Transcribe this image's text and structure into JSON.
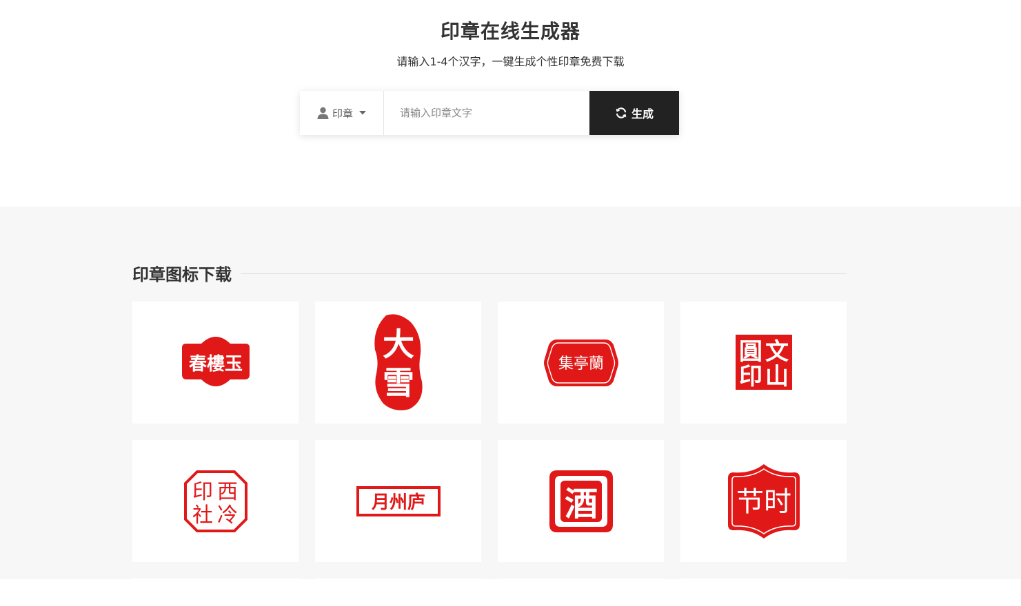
{
  "hero": {
    "title": "印章在线生成器",
    "subtitle": "请输入1-4个汉字，一键生成个性印章免费下载"
  },
  "search": {
    "type_label": "印章",
    "placeholder": "请输入印章文字",
    "value": "",
    "generate_label": "生成"
  },
  "gallery": {
    "title": "印章图标下载",
    "stamps": [
      {
        "text": "春樓玉",
        "shape": "arched-rectangle"
      },
      {
        "chars": [
          "大",
          "雪"
        ],
        "shape": "irregular-oval"
      },
      {
        "text": "集亭蘭",
        "shape": "rounded-hexagon"
      },
      {
        "chars": [
          "圓",
          "文",
          "印",
          "山"
        ],
        "shape": "square"
      },
      {
        "chars": [
          "印",
          "西",
          "社",
          "冷"
        ],
        "shape": "octagon-outline"
      },
      {
        "text": "月州庐",
        "shape": "rectangle-outline"
      },
      {
        "text": "酒",
        "shape": "rough-square"
      },
      {
        "text": "节时",
        "shape": "shield"
      }
    ]
  },
  "colors": {
    "seal_red": "#e01818",
    "button_dark": "#222222",
    "gallery_bg": "#f7f7f7"
  }
}
